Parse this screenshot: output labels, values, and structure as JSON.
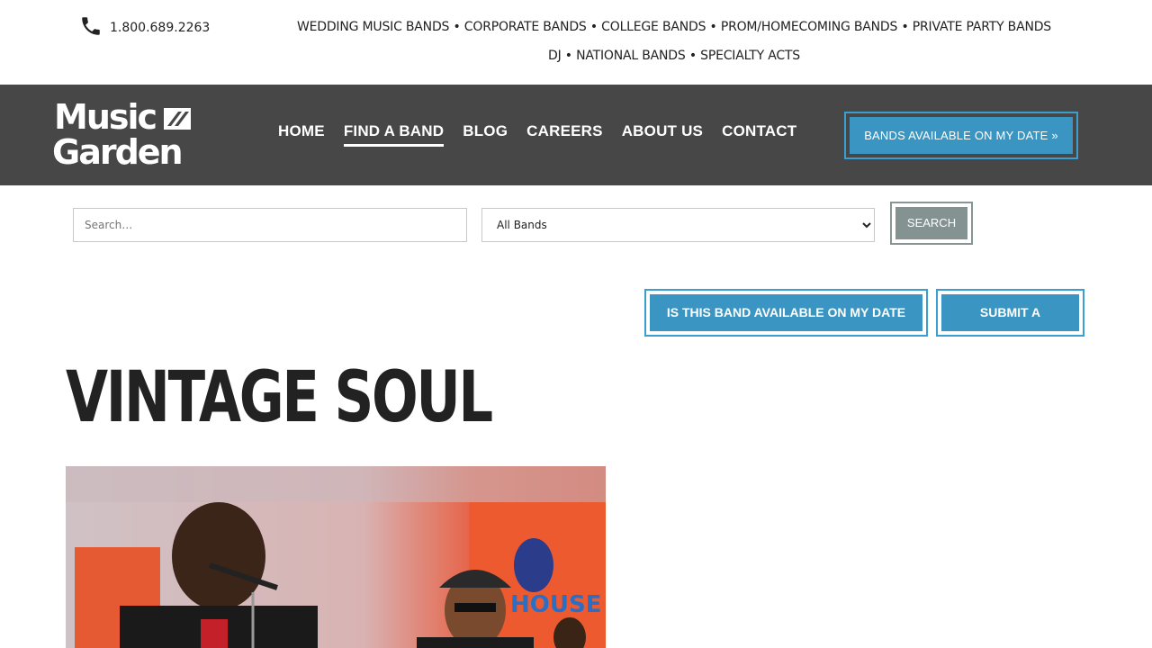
{
  "topbar": {
    "phone": "1.800.689.2263",
    "phone_icon": "phone-icon",
    "categories_line1": [
      "WEDDING MUSIC BANDS",
      "CORPORATE BANDS",
      "COLLEGE BANDS",
      "PROM/HOMECOMING BANDS",
      "PRIVATE PARTY BANDS"
    ],
    "categories_line2": [
      "DJ",
      "NATIONAL BANDS",
      "SPECIALTY ACTS"
    ],
    "separator": " • "
  },
  "header": {
    "logo": "Music Garden",
    "nav": [
      {
        "label": "HOME",
        "active": false
      },
      {
        "label": "FIND A BAND",
        "active": true
      },
      {
        "label": "BLOG",
        "active": false
      },
      {
        "label": "CAREERS",
        "active": false
      },
      {
        "label": "ABOUT US",
        "active": false
      },
      {
        "label": "CONTACT",
        "active": false
      }
    ],
    "availability_button": "BANDS AVAILABLE ON MY DATE »"
  },
  "search": {
    "placeholder": "Search…",
    "select_value": "All Bands",
    "button": "SEARCH"
  },
  "actions": {
    "availability": "IS THIS BAND AVAILABLE ON MY DATE »",
    "review": "SUBMIT A REVIEW"
  },
  "band": {
    "title": "VINTAGE SOUL"
  },
  "colors": {
    "navbar": "#474747",
    "accent": "#3a95c2",
    "search_button": "#859292"
  }
}
